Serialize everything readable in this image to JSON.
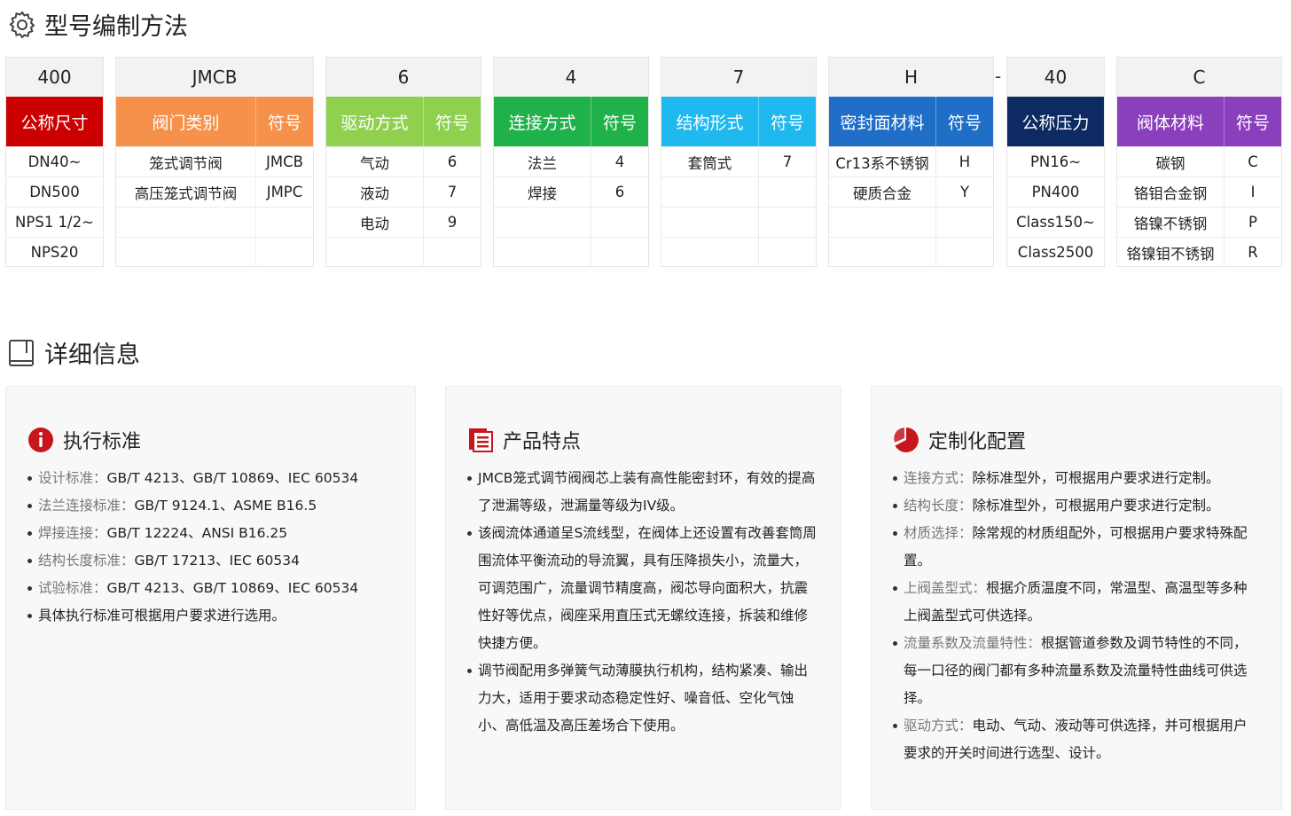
{
  "section1": {
    "title": "型号编制方法",
    "icon": "gear-icon"
  },
  "section2": {
    "title": "详细信息",
    "icon": "book-icon"
  },
  "separator": "-",
  "groups": [
    {
      "code": "400",
      "color": "#cc0000",
      "headers": [
        "公称尺寸"
      ],
      "rows": [
        [
          "DN40~"
        ],
        [
          "DN500"
        ],
        [
          "NPS1 1/2~"
        ],
        [
          "NPS20"
        ]
      ]
    },
    {
      "code": "JMCB",
      "color": "#f5914a",
      "headers": [
        "阀门类别",
        "符号"
      ],
      "rows": [
        [
          "笼式调节阀",
          "JMCB"
        ],
        [
          "高压笼式调节阀",
          "JMPC"
        ],
        [
          "",
          ""
        ],
        [
          "",
          ""
        ]
      ]
    },
    {
      "code": "6",
      "color": "#8fd14f",
      "headers": [
        "驱动方式",
        "符号"
      ],
      "rows": [
        [
          "气动",
          "6"
        ],
        [
          "液动",
          "7"
        ],
        [
          "电动",
          "9"
        ],
        [
          "",
          ""
        ]
      ]
    },
    {
      "code": "4",
      "color": "#20b24a",
      "headers": [
        "连接方式",
        "符号"
      ],
      "rows": [
        [
          "法兰",
          "4"
        ],
        [
          "焊接",
          "6"
        ],
        [
          "",
          ""
        ],
        [
          "",
          ""
        ]
      ]
    },
    {
      "code": "7",
      "color": "#1fb8ef",
      "headers": [
        "结构形式",
        "符号"
      ],
      "rows": [
        [
          "套筒式",
          "7"
        ],
        [
          "",
          ""
        ],
        [
          "",
          ""
        ],
        [
          "",
          ""
        ]
      ]
    },
    {
      "code": "H",
      "color": "#1f6ec8",
      "headers": [
        "密封面材料",
        "符号"
      ],
      "rows": [
        [
          "Cr13系不锈钢",
          "H"
        ],
        [
          "硬质合金",
          "Y"
        ],
        [
          "",
          ""
        ],
        [
          "",
          ""
        ]
      ]
    },
    {
      "code": "40",
      "color": "#0d2a63",
      "headers": [
        "公称压力"
      ],
      "rows": [
        [
          "PN16~"
        ],
        [
          "PN400"
        ],
        [
          "Class150~"
        ],
        [
          "Class2500"
        ]
      ]
    },
    {
      "code": "C",
      "color": "#8a3fbd",
      "headers": [
        "阀体材料",
        "符号"
      ],
      "rows": [
        [
          "碳钢",
          "C"
        ],
        [
          "铬钼合金钢",
          "I"
        ],
        [
          "铬镍不锈钢",
          "P"
        ],
        [
          "铬镍钼不锈钢",
          "R"
        ]
      ]
    }
  ],
  "cards": [
    {
      "title": "执行标准",
      "icon": "info-circle-icon",
      "items": [
        {
          "label": "设计标准：",
          "text": "GB/T 4213、GB/T 10869、IEC 60534"
        },
        {
          "label": "法兰连接标准：",
          "text": "GB/T 9124.1、ASME B16.5"
        },
        {
          "label": "焊接连接：",
          "text": "GB/T 12224、ANSI B16.25"
        },
        {
          "label": "结构长度标准：",
          "text": "GB/T 17213、IEC 60534"
        },
        {
          "label": "试验标准：",
          "text": "GB/T 4213、GB/T 10869、IEC 60534"
        },
        {
          "label": "",
          "text": "具体执行标准可根据用户要求进行选用。"
        }
      ]
    },
    {
      "title": "产品特点",
      "icon": "document-list-icon",
      "items": [
        {
          "label": "",
          "text": "JMCB笼式调节阀阀芯上装有高性能密封环，有效的提高了泄漏等级，泄漏量等级为IV级。"
        },
        {
          "label": "",
          "text": "该阀流体通道呈S流线型，在阀体上还设置有改善套筒周围流体平衡流动的导流翼，具有压降损失小，流量大，可调范围广，流量调节精度高，阀芯导向面积大，抗震性好等优点，阀座采用直压式无螺纹连接，拆装和维修快捷方便。"
        },
        {
          "label": "",
          "text": "调节阀配用多弹簧气动薄膜执行机构，结构紧凑、输出力大，适用于要求动态稳定性好、噪音低、空化气蚀小、高低温及高压差场合下使用。"
        }
      ]
    },
    {
      "title": "定制化配置",
      "icon": "pie-chart-icon",
      "items": [
        {
          "label": "连接方式：",
          "text": "除标准型外，可根据用户要求进行定制。"
        },
        {
          "label": "结构长度：",
          "text": "除标准型外，可根据用户要求进行定制。"
        },
        {
          "label": "材质选择：",
          "text": "除常规的材质组配外，可根据用户要求特殊配置。"
        },
        {
          "label": "上阀盖型式：",
          "text": "根据介质温度不同，常温型、高温型等多种上阀盖型式可供选择。"
        },
        {
          "label": "流量系数及流量特性：",
          "text": "根据管道参数及调节特性的不同，每一口径的阀门都有多种流量系数及流量特性曲线可供选择。"
        },
        {
          "label": "驱动方式：",
          "text": "电动、气动、液动等可供选择，并可根据用户要求的开关时间进行选型、设计。"
        }
      ]
    }
  ]
}
